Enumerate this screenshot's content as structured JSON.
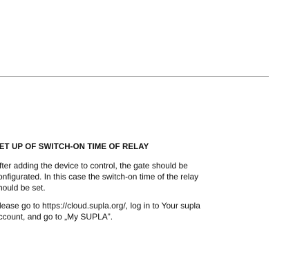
{
  "section": {
    "heading": "SET UP OF SWITCH-ON TIME OF RELAY",
    "paragraphs": [
      {
        "lines": [
          "After adding the device to control, the gate should be",
          "configurated. In this case the switch-on time of the relay",
          "should be set."
        ]
      },
      {
        "lines": [
          "Please go to https://cloud.supla.org/, log in to Your supla",
          "account, and go to „My SUPLA”."
        ]
      }
    ]
  }
}
